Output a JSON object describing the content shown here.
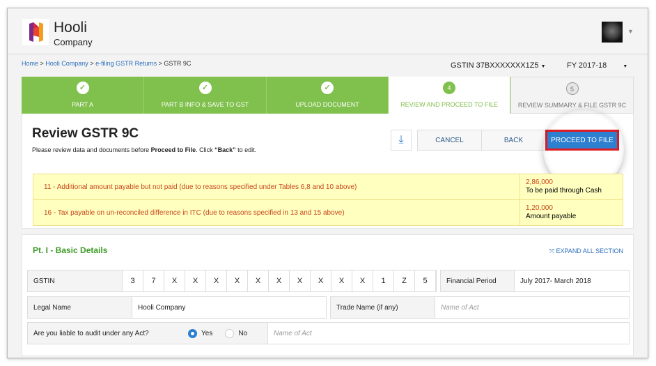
{
  "header": {
    "brand": "Hooli",
    "sub": "Company"
  },
  "breadcrumb": [
    "Home",
    "Hooli Company",
    "e-filing GSTR Returns",
    "GSTR 9C"
  ],
  "gstin_select": "GSTIN 37BXXXXXXX1Z5",
  "fy_select": "FY 2017-18",
  "steps": [
    {
      "n": "✓",
      "label": "PART A"
    },
    {
      "n": "✓",
      "label": "PART B INFO & SAVE TO GST"
    },
    {
      "n": "✓",
      "label": "UPLOAD DOCUMENT"
    },
    {
      "n": "4",
      "label": "REVIEW AND PROCEED TO FILE"
    },
    {
      "n": "5",
      "label": "REVIEW SUMMARY & FILE GSTR 9C"
    }
  ],
  "review": {
    "title": "Review GSTR 9C",
    "sub_pre": "Please review data and documents before ",
    "sub_b1": "Proceed to File",
    "sub_mid": ". Click ",
    "sub_b2": "“Back”",
    "sub_post": " to edit.",
    "cancel": "CANCEL",
    "back": "BACK",
    "proceed": "PROCEED TO FILE"
  },
  "warnings": [
    {
      "text": "11 - Additional amount payable but not paid (due to reasons specified under Tables 6,8 and 10 above)",
      "amount": "2,86,000",
      "note": "To be paid through Cash"
    },
    {
      "text": "16 - Tax payable on un-reconciled difference in ITC (due to reasons specified in 13 and 15 above)",
      "amount": "1,20,000",
      "note": "Amount payable"
    }
  ],
  "basic": {
    "title": "Pt. I - Basic Details",
    "expand": "EXPAND ALL SECTION",
    "gstin_label": "GSTIN",
    "gstin_chars": [
      "3",
      "7",
      "X",
      "X",
      "X",
      "X",
      "X",
      "X",
      "X",
      "X",
      "X",
      "X",
      "1",
      "Z",
      "5"
    ],
    "fp_label": "Financial Period",
    "fp_value": "July 2017- March 2018",
    "legal_label": "Legal Name",
    "legal_value": "Hooli Company",
    "trade_label": "Trade Name (if any)",
    "trade_placeholder": "Name of Act",
    "audit_label": "Are you liable to audit under any Act?",
    "yes": "Yes",
    "no": "No",
    "audit_selected": "Yes",
    "act_placeholder": "Name of Act"
  },
  "colors": {
    "green": "#80c04d",
    "blue": "#2d7fd0",
    "highlight": "#e11b22"
  }
}
